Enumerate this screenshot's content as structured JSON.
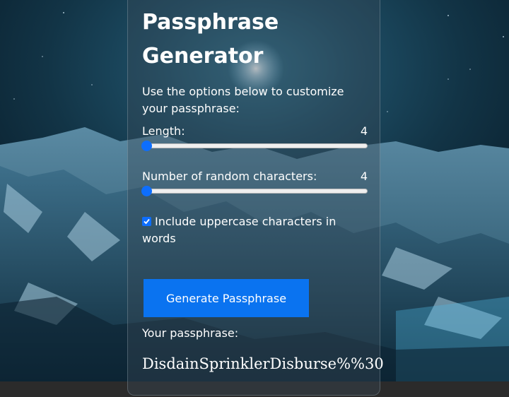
{
  "generator": {
    "title": "Passphrase Generator",
    "intro": "Use the options below to customize your passphrase:",
    "length": {
      "label": "Length:",
      "value": "4",
      "fraction": 0
    },
    "random_chars": {
      "label": "Number of random characters:",
      "value": "4",
      "fraction": 0
    },
    "uppercase": {
      "label": "Include uppercase characters in words",
      "checked": true
    },
    "generate_button": "Generate Passphrase",
    "result_label": "Your passphrase:",
    "result": "DisdainSprinklerDisburse%%30"
  },
  "colors": {
    "accent": "#0a73f0",
    "slider_accent": "#0d6efd"
  }
}
